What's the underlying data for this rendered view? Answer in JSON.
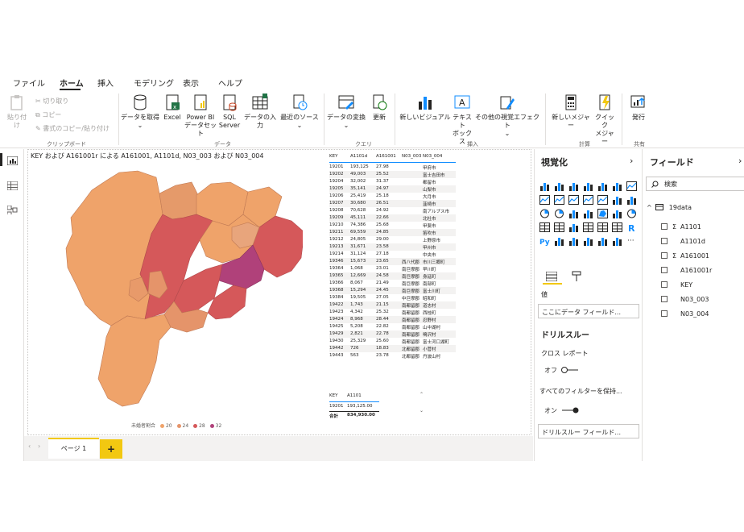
{
  "ribbon": {
    "tabs": [
      "ファイル",
      "ホーム",
      "挿入",
      "モデリング",
      "表示",
      "ヘルプ"
    ],
    "active_tab": "ホーム",
    "clipboard": {
      "paste": "貼り付け",
      "cut": "切り取り",
      "copy": "コピー",
      "format_painter": "書式のコピー/貼り付け",
      "group": "クリップボード"
    },
    "data": {
      "get_data": "データを取得",
      "excel": "Excel",
      "powerbi_1": "Power BI",
      "powerbi_2": "データセット",
      "sql_1": "SQL",
      "sql_2": "Server",
      "enter_data": "データの入力",
      "recent": "最近のソース",
      "group": "データ"
    },
    "query": {
      "transform": "データの変換",
      "refresh": "更新",
      "group": "クエリ"
    },
    "insert": {
      "new_visual": "新しいビジュアル",
      "textbox_1": "テキスト",
      "textbox_2": "ボックス",
      "more_visuals": "その他の視覚エフェクト",
      "group": "挿入"
    },
    "calc": {
      "new_measure": "新しいメジャー",
      "quick_1": "クイック",
      "quick_2": "メジャー",
      "group": "計算"
    },
    "share": {
      "publish": "発行",
      "group": "共有"
    }
  },
  "map": {
    "title": "KEY および A161001r による A161001, A1101d, N03_003 および N03_004",
    "legend_title": "未婚者割合",
    "legend": [
      {
        "label": "20",
        "color": "#efa36a"
      },
      {
        "label": "24",
        "color": "#e5946a"
      },
      {
        "label": "28",
        "color": "#d5585a"
      },
      {
        "label": "32",
        "color": "#b0417a"
      }
    ]
  },
  "table": {
    "headers": [
      "KEY",
      "A1101d",
      "A161001",
      "N03_003",
      "N03_004"
    ],
    "rows": [
      [
        "19201",
        "193,125",
        "27.98",
        "",
        "甲府市"
      ],
      [
        "19202",
        "49,003",
        "25.52",
        "",
        "富士吉田市"
      ],
      [
        "19204",
        "32,002",
        "31.37",
        "",
        "都留市"
      ],
      [
        "19205",
        "35,141",
        "24.97",
        "",
        "山梨市"
      ],
      [
        "19206",
        "25,419",
        "25.18",
        "",
        "大月市"
      ],
      [
        "19207",
        "30,680",
        "26.51",
        "",
        "韮崎市"
      ],
      [
        "19208",
        "70,628",
        "24.92",
        "",
        "南アルプス市"
      ],
      [
        "19209",
        "45,111",
        "22.66",
        "",
        "北杜市"
      ],
      [
        "19210",
        "74,386",
        "25.68",
        "",
        "甲斐市"
      ],
      [
        "19211",
        "69,559",
        "24.85",
        "",
        "笛吹市"
      ],
      [
        "19212",
        "24,805",
        "29.00",
        "",
        "上野原市"
      ],
      [
        "19213",
        "31,671",
        "23.58",
        "",
        "甲州市"
      ],
      [
        "19214",
        "31,124",
        "27.18",
        "",
        "中央市"
      ],
      [
        "19346",
        "15,673",
        "23.65",
        "西八代郡",
        "市川三郷町"
      ],
      [
        "19364",
        "1,068",
        "23.01",
        "南巨摩郡",
        "早川町"
      ],
      [
        "19365",
        "12,669",
        "24.58",
        "南巨摩郡",
        "身延町"
      ],
      [
        "19366",
        "8,067",
        "21.49",
        "南巨摩郡",
        "南部町"
      ],
      [
        "19368",
        "15,294",
        "24.45",
        "南巨摩郡",
        "富士川町"
      ],
      [
        "19384",
        "19,505",
        "27.05",
        "中巨摩郡",
        "昭和町"
      ],
      [
        "19422",
        "1,743",
        "21.15",
        "南都留郡",
        "道志村"
      ],
      [
        "19423",
        "4,342",
        "25.32",
        "南都留郡",
        "西桂町"
      ],
      [
        "19424",
        "8,968",
        "28.44",
        "南都留郡",
        "忍野村"
      ],
      [
        "19425",
        "5,208",
        "22.82",
        "南都留郡",
        "山中湖村"
      ],
      [
        "19429",
        "2,821",
        "22.78",
        "南都留郡",
        "鳴沢村"
      ],
      [
        "19430",
        "25,329",
        "25.60",
        "南都留郡",
        "富士河口湖町"
      ],
      [
        "19442",
        "726",
        "18.83",
        "北都留郡",
        "小菅村"
      ],
      [
        "19443",
        "563",
        "23.78",
        "北都留郡",
        "丹波山村"
      ]
    ]
  },
  "table2": {
    "headers": [
      "KEY",
      "A1101"
    ],
    "row": [
      "19201",
      "193,125.00"
    ],
    "total_label": "合計",
    "total_value": "834,930.00"
  },
  "pages": {
    "tab": "ページ 1",
    "add": "+"
  },
  "viz_pane": {
    "title": "視覚化",
    "values_label": "値",
    "values_placeholder": "ここにデータ フィールド...",
    "drillthrough_title": "ドリルスルー",
    "cross_report": "クロス レポート",
    "cross_report_state": "オフ",
    "keep_filters": "すべてのフィルターを保持...",
    "keep_filters_state": "オン",
    "drill_placeholder": "ドリルスルー フィールド..."
  },
  "fields_pane": {
    "title": "フィールド",
    "search_placeholder": "検索",
    "table_name": "19data",
    "fields": [
      {
        "name": "A1101",
        "sigma": true
      },
      {
        "name": "A1101d",
        "sigma": false
      },
      {
        "name": "A161001",
        "sigma": true
      },
      {
        "name": "A161001r",
        "sigma": false
      },
      {
        "name": "KEY",
        "sigma": false
      },
      {
        "name": "N03_003",
        "sigma": false
      },
      {
        "name": "N03_004",
        "sigma": false
      }
    ]
  }
}
